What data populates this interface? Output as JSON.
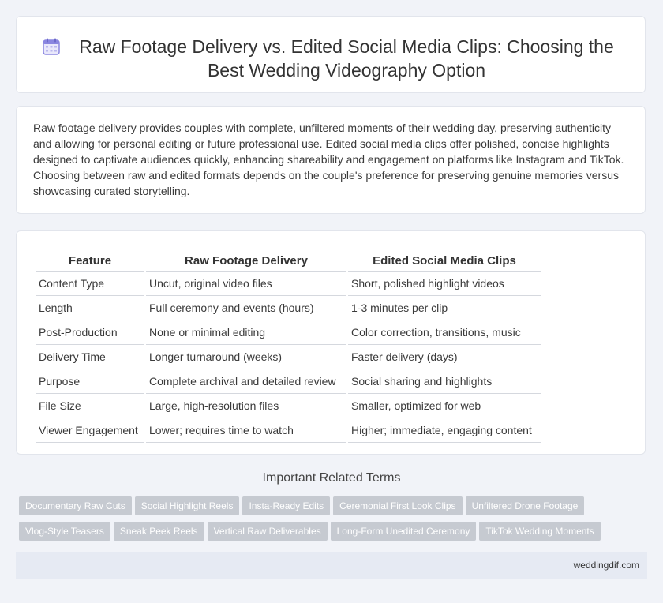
{
  "header": {
    "icon": "calendar-icon",
    "title": "Raw Footage Delivery vs. Edited Social Media Clips: Choosing the Best Wedding Videography Option"
  },
  "intro": {
    "text": "Raw footage delivery provides couples with complete, unfiltered moments of their wedding day, preserving authenticity and allowing for personal editing or future professional use. Edited social media clips offer polished, concise highlights designed to captivate audiences quickly, enhancing shareability and engagement on platforms like Instagram and TikTok. Choosing between raw and edited formats depends on the couple's preference for preserving genuine memories versus showcasing curated storytelling."
  },
  "table": {
    "headers": [
      "Feature",
      "Raw Footage Delivery",
      "Edited Social Media Clips"
    ],
    "rows": [
      [
        "Content Type",
        "Uncut, original video files",
        "Short, polished highlight videos"
      ],
      [
        "Length",
        "Full ceremony and events (hours)",
        "1-3 minutes per clip"
      ],
      [
        "Post-Production",
        "None or minimal editing",
        "Color correction, transitions, music"
      ],
      [
        "Delivery Time",
        "Longer turnaround (weeks)",
        "Faster delivery (days)"
      ],
      [
        "Purpose",
        "Complete archival and detailed review",
        "Social sharing and highlights"
      ],
      [
        "File Size",
        "Large, high-resolution files",
        "Smaller, optimized for web"
      ],
      [
        "Viewer Engagement",
        "Lower; requires time to watch",
        "Higher; immediate, engaging content"
      ]
    ]
  },
  "terms": {
    "title": "Important Related Terms",
    "items": [
      "Documentary Raw Cuts",
      "Social Highlight Reels",
      "Insta-Ready Edits",
      "Ceremonial First Look Clips",
      "Unfiltered Drone Footage",
      "Vlog-Style Teasers",
      "Sneak Peek Reels",
      "Vertical Raw Deliverables",
      "Long-Form Unedited Ceremony",
      "TikTok Wedding Moments"
    ]
  },
  "footer": {
    "site": "weddingdif.com"
  },
  "colors": {
    "accent": "#7b7fd4",
    "tag_bg": "#c6cad1",
    "footer_bg": "#e6eaf3"
  }
}
